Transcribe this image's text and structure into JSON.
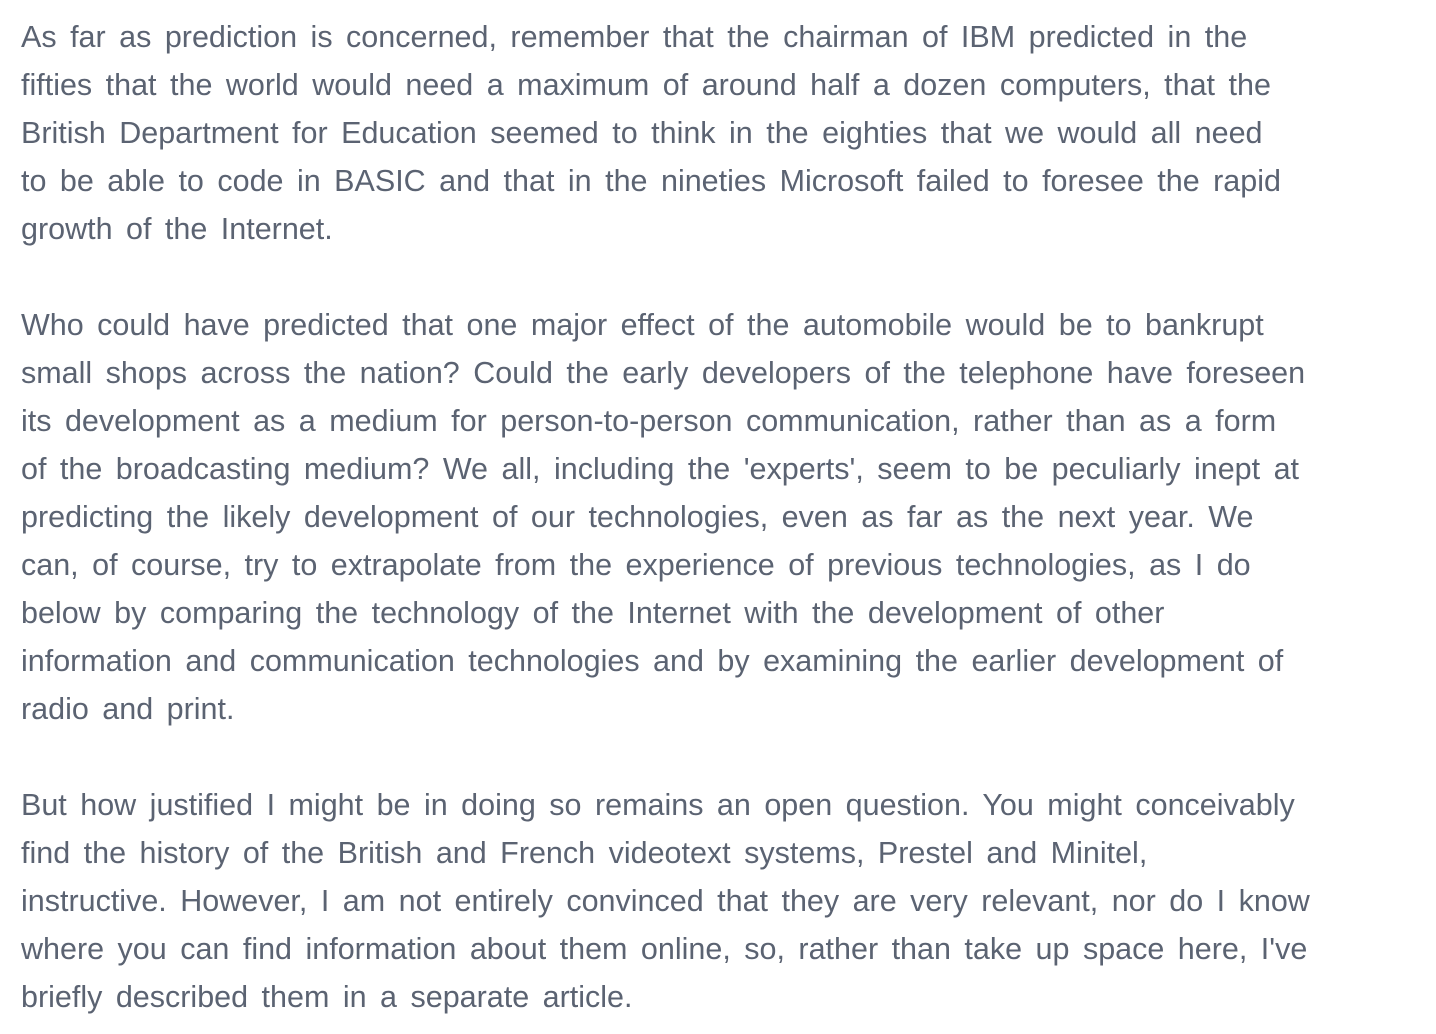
{
  "article": {
    "paragraphs": [
      {
        "lines": [
          "As far as prediction is concerned, remember that the chairman of IBM predicted in the",
          "fifties that the world would need a maximum of around half a dozen computers, that the",
          "British Department for Education seemed to think in the eighties that we would all need",
          "to be able to code in BASIC and that in the nineties Microsoft failed to foresee the rapid",
          "growth of the Internet."
        ]
      },
      {
        "lines": [
          "Who could have predicted that one major effect of the automobile would be to bankrupt",
          "small shops across the nation? Could the early developers of the telephone have foreseen",
          "its development as a medium for person-to-person communication, rather than as a form",
          "of the broadcasting medium? We all, including the 'experts', seem to be peculiarly inept at",
          "predicting the likely development of our technologies, even as far as the next year. We",
          "can, of course, try to extrapolate from the experience of previous technologies, as I do",
          "below by comparing the technology of the Internet with the development of other",
          "information and communication technologies and by examining the earlier development of",
          "radio and print."
        ]
      },
      {
        "lines": [
          "But how justified I might be in doing so remains an open question. You might conceivably",
          "find the history of the British and French videotext systems, Prestel and Minitel,",
          "instructive. However, I am not entirely convinced that they are very relevant, nor do I know",
          "where you can find information about them online, so, rather than take up space here, I've",
          "briefly described them in a separate article."
        ]
      }
    ]
  }
}
